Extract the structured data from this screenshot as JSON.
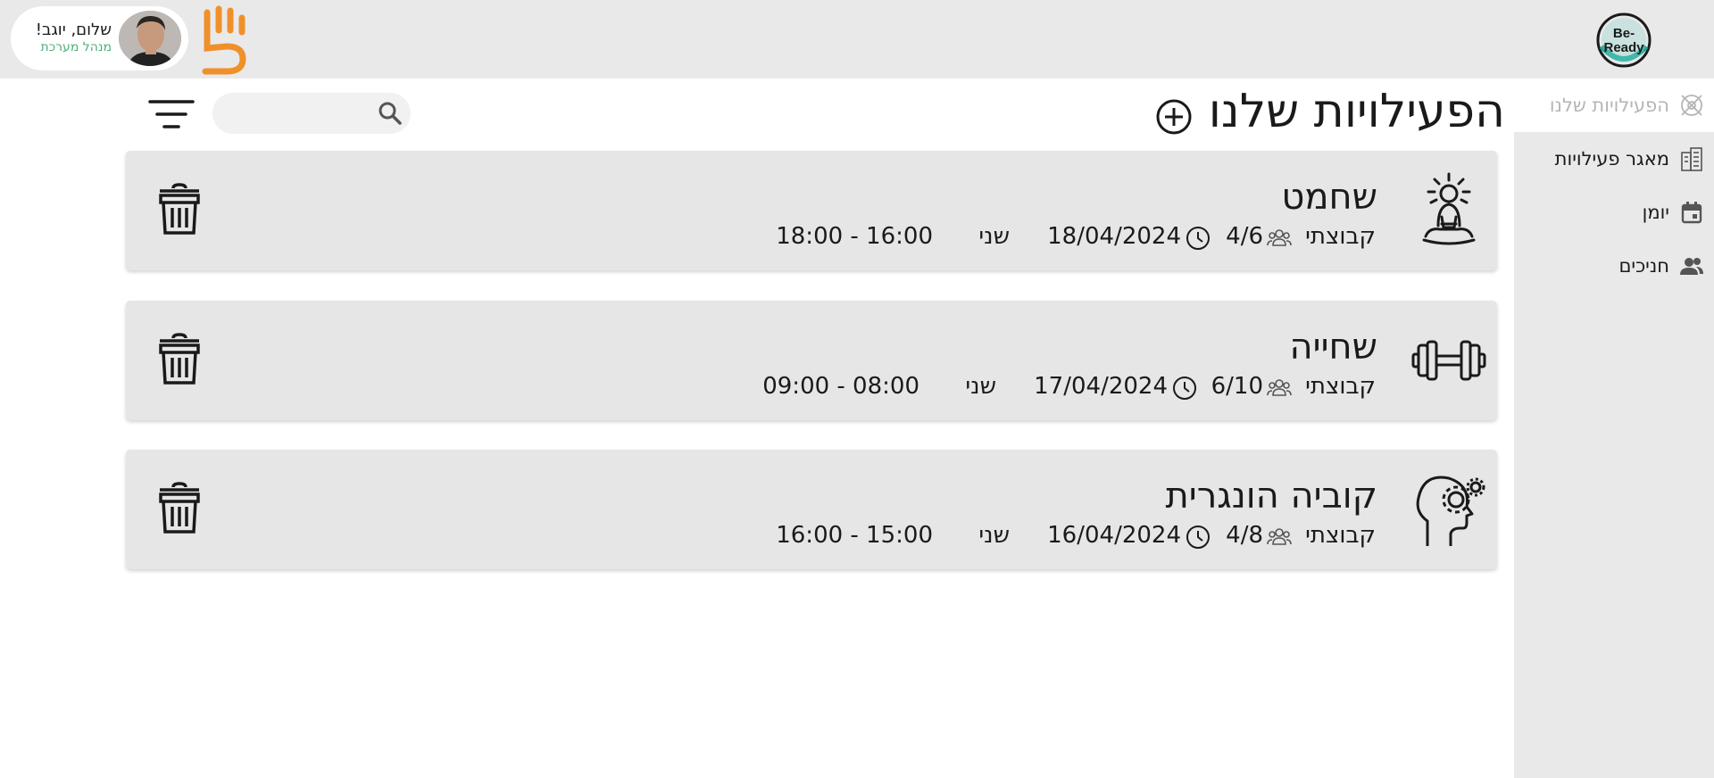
{
  "header": {
    "greeting": "שלום, יוגב!",
    "role": "מנהל מערכת",
    "avatar_icon": "user-avatar",
    "brand_logo_icon": "hand-five-logo",
    "app_logo_text": "Be-Ready",
    "accent_color": "#f0902a",
    "logo_color": "#1aa79a"
  },
  "sidebar": {
    "items": [
      {
        "label": "הפעילויות שלנו",
        "icon": "activities-icon",
        "active": true
      },
      {
        "label": "מאגר פעילויות",
        "icon": "library-icon",
        "active": false
      },
      {
        "label": "יומן",
        "icon": "calendar-icon",
        "active": false
      },
      {
        "label": "חניכים",
        "icon": "people-icon",
        "active": false
      }
    ]
  },
  "main": {
    "title": "הפעילויות שלנו",
    "search": {
      "placeholder": "",
      "value": ""
    },
    "activities": [
      {
        "name": "שחמט",
        "icon": "meditation-icon",
        "type": "קבוצתי",
        "participants": "4/6",
        "date": "18/04/2024",
        "day": "שני",
        "time": "18:00 - 16:00"
      },
      {
        "name": "שחייה",
        "icon": "dumbbell-icon",
        "type": "קבוצתי",
        "participants": "6/10",
        "date": "17/04/2024",
        "day": "שני",
        "time": "09:00 - 08:00"
      },
      {
        "name": "קוביה הונגרית",
        "icon": "brain-gear-icon",
        "type": "קבוצתי",
        "participants": "4/8",
        "date": "16/04/2024",
        "day": "שני",
        "time": "16:00 - 15:00"
      }
    ]
  }
}
